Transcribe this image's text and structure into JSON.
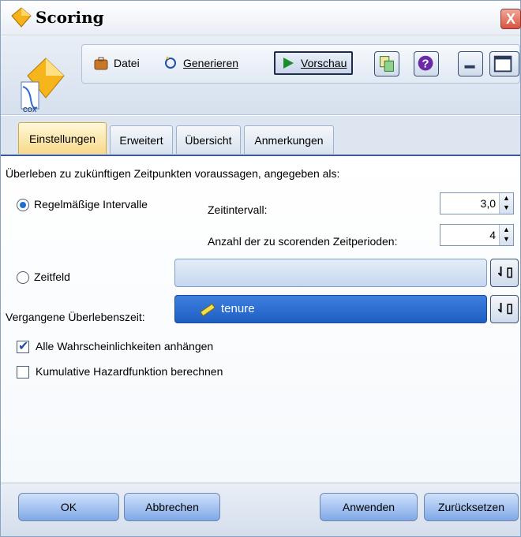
{
  "window": {
    "title": "Scoring",
    "close_label": "X"
  },
  "node": {
    "label": "COX"
  },
  "toolbar": {
    "file_label": "Datei",
    "generate_label": "Generieren",
    "preview_label": "Vorschau",
    "icons": [
      "briefcase-icon",
      "sparkle-icon",
      "play-icon",
      "copy-icon",
      "help-icon",
      "minimize-icon",
      "maximize-icon"
    ]
  },
  "tabs": [
    "Einstellungen",
    "Erweitert",
    "Übersicht",
    "Anmerkungen"
  ],
  "active_tab": "Einstellungen",
  "settings": {
    "heading": "Überleben zu zukünftigen Zeitpunkten voraussagen, angegeben als:",
    "regular_intervals_label": "Regelmäßige Intervalle",
    "time_interval_label": "Zeitintervall:",
    "time_interval_value": "3,0",
    "periods_label": "Anzahl der zu scorenden Zeitperioden:",
    "periods_value": "4",
    "time_field_label": "Zeitfeld",
    "time_field_value": "",
    "past_survival_label": "Vergangene Überlebenszeit:",
    "past_survival_value": "tenure",
    "append_all_label": "Alle Wahrscheinlichkeiten anhängen",
    "append_all_checked": true,
    "cumulative_hazard_label": "Kumulative Hazardfunktion berechnen",
    "cumulative_hazard_checked": false,
    "regular_selected": true
  },
  "buttons": {
    "ok": "OK",
    "cancel": "Abbrechen",
    "apply": "Anwenden",
    "reset": "Zurücksetzen"
  },
  "colors": {
    "accent": "#3b5998",
    "active_tab": "#f7d98a",
    "selected_field": "#1f5fc2"
  }
}
